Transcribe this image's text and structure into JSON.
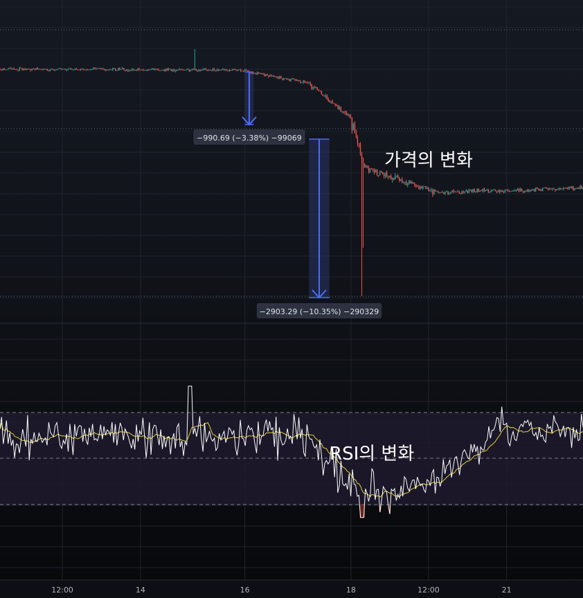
{
  "chart_data": [
    {
      "type": "candlestick",
      "panel": "price",
      "colors": {
        "up": "#26a69a",
        "down": "#ef5350"
      },
      "y_range_index": [
        0,
        100
      ],
      "segments": [
        {
          "from": 0,
          "to": 0.415,
          "start": 83,
          "end": 82.6,
          "noise": 0.5
        },
        {
          "from": 0.415,
          "to": 0.53,
          "start": 82.6,
          "end": 78,
          "noise": 0.6
        },
        {
          "from": 0.53,
          "to": 0.6,
          "start": 78,
          "end": 66,
          "noise": 0.9
        },
        {
          "from": 0.6,
          "to": 0.625,
          "start": 66,
          "end": 48,
          "noise": 2.2
        },
        {
          "from": 0.625,
          "to": 0.7,
          "start": 48,
          "end": 43,
          "noise": 1.4
        },
        {
          "from": 0.7,
          "to": 0.75,
          "start": 43,
          "end": 39.5,
          "noise": 1.0
        },
        {
          "from": 0.75,
          "to": 1.0,
          "start": 39.5,
          "end": 41,
          "noise": 0.7
        }
      ],
      "annotation": "가격의 변화"
    },
    {
      "type": "line",
      "panel": "indicator",
      "series": [
        {
          "color": "#ffffff"
        },
        {
          "color": "#e5d33a"
        }
      ],
      "ylim": [
        0,
        100
      ],
      "levels": [
        70,
        50,
        30
      ],
      "annotation": "RSI의 변화"
    }
  ],
  "x_axis": {
    "ticks": [
      {
        "label": "12:00",
        "pos": 0.107
      },
      {
        "label": "14",
        "pos": 0.241
      },
      {
        "label": "16",
        "pos": 0.42
      },
      {
        "label": "18",
        "pos": 0.602
      },
      {
        "label": "12:00",
        "pos": 0.735
      },
      {
        "label": "21",
        "pos": 0.869
      }
    ]
  },
  "measures": [
    {
      "label": "−990.69 (−3.38%) −99069",
      "from_pos": 0.42,
      "to_pos": 0.435,
      "start_price": 82.6,
      "end_price": 80.1
    },
    {
      "label": "−2903.29 (−10.35%) −290329",
      "from_pos": 0.53,
      "to_pos": 0.565,
      "start_price": 80.1,
      "end_price": 73.1
    }
  ],
  "colors": {
    "background": "#0d0f14",
    "grid": "#20242e",
    "measure": "#4f6cf2",
    "measure_fill": "#2a3566",
    "rsi_band": "#1e1a2e",
    "oversold_fill": "#8b2a1e"
  }
}
